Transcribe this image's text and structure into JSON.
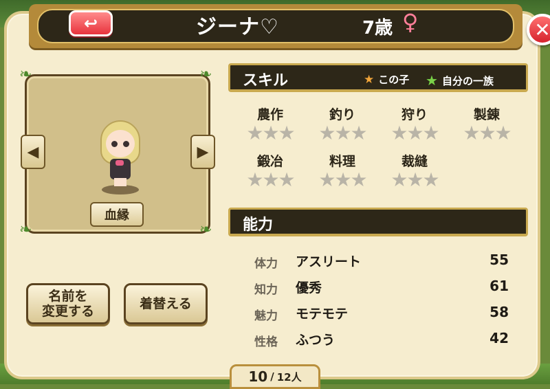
{
  "header": {
    "back_icon": "↩",
    "name": "ジーナ♡",
    "age": "7歳",
    "gender_symbol": "♀"
  },
  "close_icon": "✕",
  "portrait": {
    "left_arrow": "◀",
    "right_arrow": "▶",
    "lineage_label": "血縁"
  },
  "actions": {
    "rename_line1": "名前を",
    "rename_line2": "変更する",
    "change_clothes": "着替える"
  },
  "skills": {
    "title": "スキル",
    "legend_child": "この子",
    "legend_clan": "自分の一族",
    "items": [
      {
        "label": "農作",
        "stars": "★★★"
      },
      {
        "label": "釣り",
        "stars": "★★★"
      },
      {
        "label": "狩り",
        "stars": "★★★"
      },
      {
        "label": "製錬",
        "stars": "★★★"
      },
      {
        "label": "鍛冶",
        "stars": "★★★"
      },
      {
        "label": "料理",
        "stars": "★★★"
      },
      {
        "label": "裁縫",
        "stars": "★★★"
      }
    ]
  },
  "abilities": {
    "title": "能力",
    "items": [
      {
        "name": "体力",
        "desc": "アスリート",
        "value": "55"
      },
      {
        "name": "知力",
        "desc": "優秀",
        "value": "61"
      },
      {
        "name": "魅力",
        "desc": "モテモテ",
        "value": "58"
      },
      {
        "name": "性格",
        "desc": "ふつう",
        "value": "42"
      }
    ]
  },
  "pager": {
    "current": "10",
    "separator": "/",
    "total": "12人"
  },
  "colors": {
    "header_bg": "#2d2718",
    "panel_bg": "#f6edcf",
    "close_red": "#d6232d",
    "gender_pink": "#ff7f9a"
  }
}
